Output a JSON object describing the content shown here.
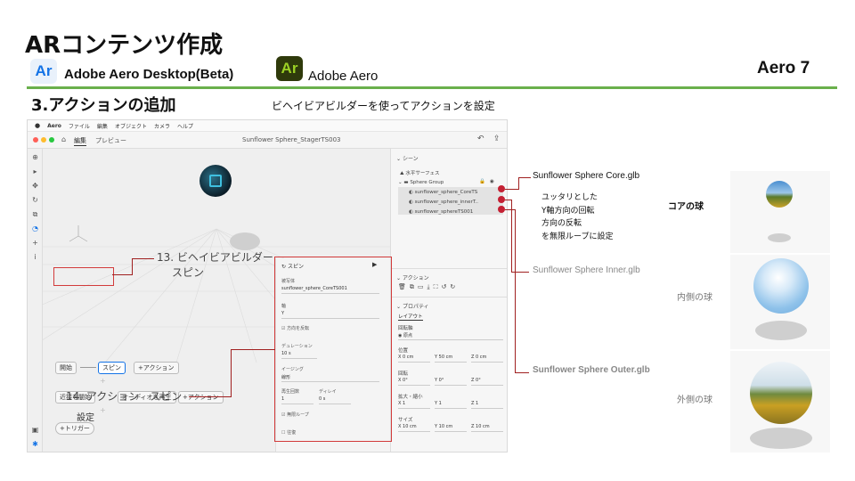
{
  "header": {
    "title": "ARコンテンツ作成",
    "logo_text": "Ar",
    "app_desktop": "Adobe Aero Desktop(Beta)",
    "app_mobile": "Adobe Aero",
    "page_tag": "Aero 7"
  },
  "section": {
    "title": "3.アクションの追加",
    "subtitle": "ビヘイビアビルダーを使ってアクションを設定"
  },
  "app": {
    "menu": [
      "Aero",
      "ファイル",
      "編集",
      "オブジェクト",
      "カメラ",
      "ヘルプ"
    ],
    "tabs": [
      "編集",
      "プレビュー"
    ],
    "doc_title": "Sunflower Sphere_StagerTS003",
    "scene": {
      "header": "シーン",
      "items": [
        "水平サーフェス",
        "Sphere Group",
        "sunflower_sphere_CoreTS",
        "sunflower_sphere_innerT..",
        "sunflower_sphereTS001"
      ]
    },
    "actions_header": "アクション",
    "properties_header": "プロパティ",
    "layout_label": "レイアウト",
    "pivot_label": "回転軸",
    "pivot_value": "原点",
    "position_label": "位置",
    "position": [
      "X 0 cm",
      "Y 50 cm",
      "Z 0 cm"
    ],
    "rotation_label": "回転",
    "rotation": [
      "X 0°",
      "Y 0°",
      "Z 0°"
    ],
    "scale_label": "拡大・縮小",
    "scale": [
      "X 1",
      "Y 1",
      "Z 1"
    ],
    "size_label": "サイズ",
    "size": [
      "X 10 cm",
      "Y 10 cm",
      "Z 10 cm"
    ],
    "behavior": {
      "row1": [
        "開始",
        "スピン",
        "+アクション"
      ],
      "row2": [
        "近接を開始",
        "オーディオを再生",
        "+アクション"
      ],
      "trigger": "+トリガー"
    },
    "spin": {
      "title": "スピン",
      "target_label": "被写体",
      "target_value": "sunflower_sphere_CoreTS001",
      "axis_label": "軸",
      "axis_value": "Y",
      "reverse_label": "方向を反転",
      "duration_label": "デュレーション",
      "duration_value": "10 s",
      "easing_label": "イージング",
      "easing_value": "線形",
      "repeat_label": "再生回数",
      "repeat_value": "1",
      "delay_label": "ディレイ",
      "delay_value": "0 s",
      "loop_label": "無限ループ",
      "pingpong_label": "往復"
    }
  },
  "annotations": {
    "behavior_builder_line1": "13. ビヘイビアビルダー",
    "behavior_builder_line2": "スピン",
    "action_line1": "14. アクション　スピン",
    "action_line2": "設定",
    "core_file": "Sunflower Sphere Core.glb",
    "core_notes": [
      "ユッタリとした",
      "Y軸方向の回転",
      "方向の反転",
      "を無限ループに設定"
    ],
    "core_label": "コアの球",
    "inner_file": "Sunflower Sphere Inner.glb",
    "inner_label": "内側の球",
    "outer_file": "Sunflower Sphere Outer.glb",
    "outer_label": "外側の球"
  },
  "colors": {
    "accent_green": "#6ab04c",
    "annotation_red": "#c42033",
    "aero_blue": "#1473e6",
    "aero_lime": "#9cd125"
  }
}
